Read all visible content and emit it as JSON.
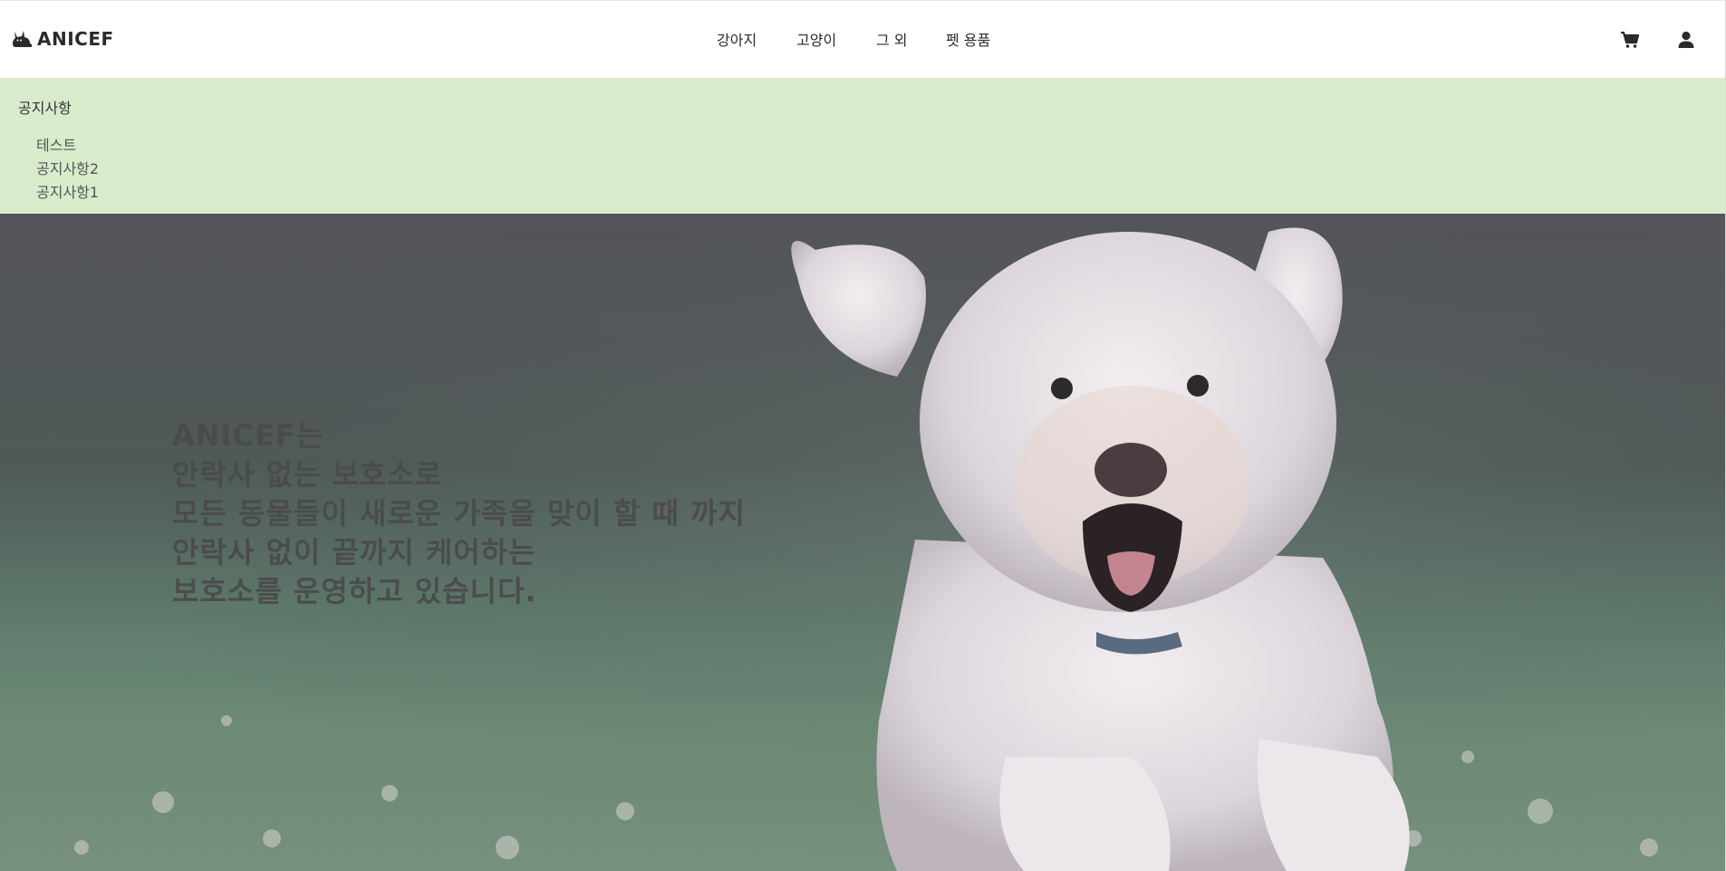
{
  "header": {
    "logo_text": "ANICEF",
    "logo_icon": "cat-icon",
    "nav": [
      {
        "label": "강아지"
      },
      {
        "label": "고양이"
      },
      {
        "label": "그 외"
      },
      {
        "label": "펫 용품"
      }
    ],
    "icons": {
      "cart": "cart-icon",
      "user": "user-icon"
    }
  },
  "notice": {
    "title": "공지사항",
    "items": [
      "테스트",
      "공지사항2",
      "공지사항1"
    ],
    "background": "#d8eccb"
  },
  "hero": {
    "lines": [
      "ANICEF는",
      "안락사 없는 보호소로",
      "모든 동물들이 새로운 가족을 맞이 할 때 까지",
      "안락사 없이 끝까지 케어하는",
      "보호소를 운영하고 있습니다."
    ],
    "image": "running-white-dog-on-grass"
  }
}
